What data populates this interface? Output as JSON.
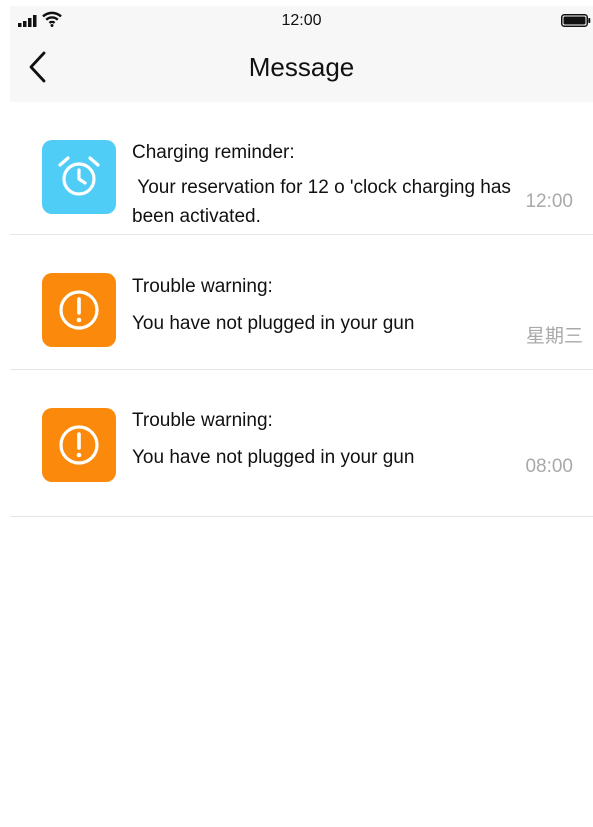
{
  "status_bar": {
    "time": "12:00",
    "icons": [
      "signal-icon",
      "wifi-icon",
      "battery-icon"
    ]
  },
  "nav": {
    "back_icon": "chevron-left-icon",
    "title": "Message"
  },
  "messages": [
    {
      "icon": "alarm-clock-icon",
      "icon_color": "#4fcdf6",
      "title": "Charging reminder:",
      "body": " Your reservation for 12 o 'clock charging has been activated.",
      "time": "12:00"
    },
    {
      "icon": "exclamation-circle-icon",
      "icon_color": "#fb8a0c",
      "title": "Trouble warning:",
      "body": "You have not plugged in your gun",
      "time": "星期三"
    },
    {
      "icon": "exclamation-circle-icon",
      "icon_color": "#fb8a0c",
      "title": "Trouble warning:",
      "body": "You have not plugged in your gun",
      "time": "08:00"
    }
  ],
  "colors": {
    "header_background": "#f7f7f7",
    "time_text": "#a9a9a9",
    "divider": "#e6e6e6"
  }
}
